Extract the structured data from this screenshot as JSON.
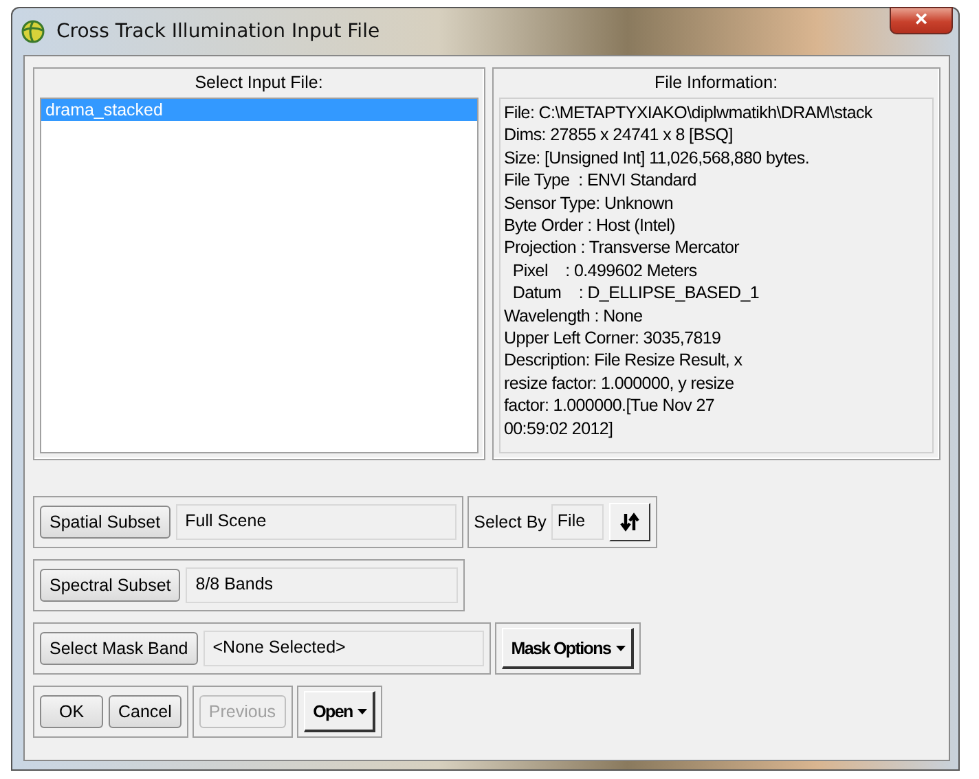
{
  "window": {
    "title": "Cross Track Illumination Input File",
    "close": "×"
  },
  "input_file": {
    "label": "Select Input File:",
    "items": [
      {
        "name": "drama_stacked",
        "selected": true
      }
    ]
  },
  "file_information": {
    "label": "File Information:",
    "lines": [
      "File: C:\\METAPTYXIAKO\\diplwmatikh\\DRAM\\stack",
      "Dims: 27855 x 24741 x 8 [BSQ]",
      "Size: [Unsigned Int] 11,026,568,880 bytes.",
      "File Type  : ENVI Standard",
      "Sensor Type: Unknown",
      "Byte Order : Host (Intel)",
      "Projection : Transverse Mercator",
      "  Pixel    : 0.499602 Meters",
      "  Datum    : D_ELLIPSE_BASED_1",
      "Wavelength : None",
      "Upper Left Corner: 3035,7819",
      "Description: File Resize Result, x",
      "resize factor: 1.000000, y resize",
      "factor: 1.000000.[Tue Nov 27",
      "00:59:02 2012]"
    ]
  },
  "spatial_subset": {
    "button": "Spatial Subset",
    "value": "Full Scene"
  },
  "select_by": {
    "label": "Select By",
    "value": "File"
  },
  "spectral_subset": {
    "button": "Spectral Subset",
    "value": "8/8 Bands"
  },
  "mask_band": {
    "button": "Select Mask Band",
    "value": "<None Selected>",
    "options": "Mask Options"
  },
  "actions": [
    {
      "label": "OK",
      "kind": "push",
      "disabled": false
    },
    {
      "label": "Cancel",
      "kind": "push",
      "disabled": false
    },
    {
      "label": "Previous",
      "kind": "push",
      "disabled": true
    },
    {
      "label": "Open",
      "kind": "menu",
      "disabled": false
    }
  ]
}
